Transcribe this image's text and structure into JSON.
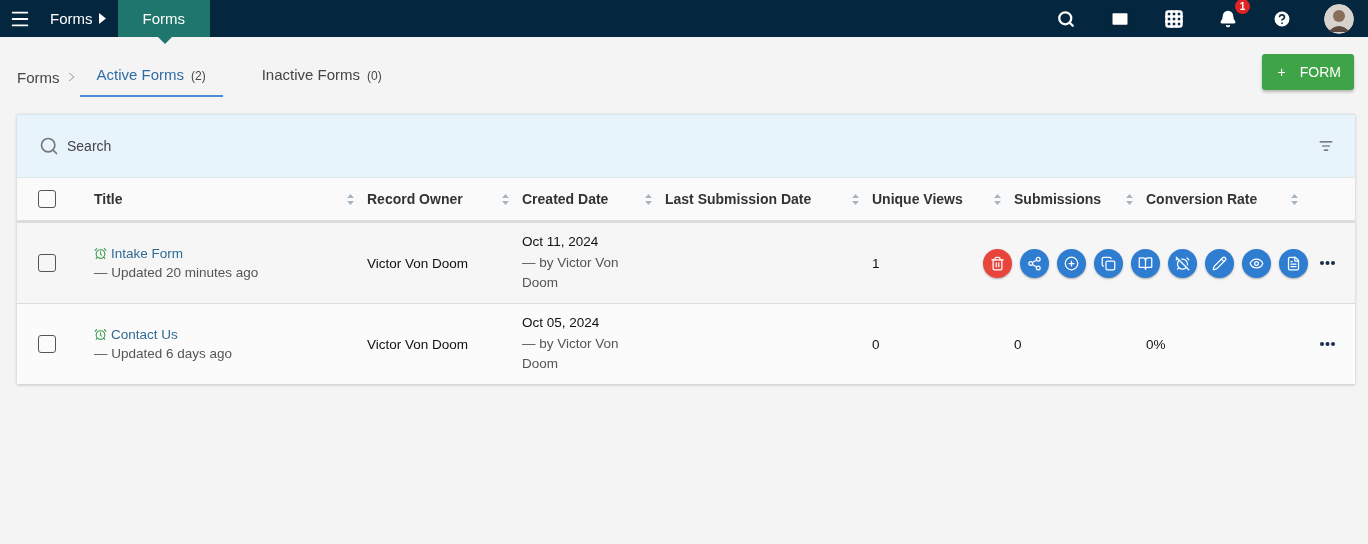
{
  "topbar": {
    "breadcrumb": "Forms",
    "current": "Forms",
    "notification_count": "1"
  },
  "tabs": {
    "root": "Forms",
    "items": [
      {
        "label": "Active Forms",
        "count": "(2)",
        "selected": true
      },
      {
        "label": "Inactive Forms",
        "count": "(0)",
        "selected": false
      }
    ]
  },
  "new_button": {
    "icon": "+",
    "label": "FORM"
  },
  "search": {
    "placeholder": "Search"
  },
  "table": {
    "select_all": {
      "checked": false
    },
    "columns": [
      "Title",
      "Record Owner",
      "Created Date",
      "Last Submission Date",
      "Unique Views",
      "Submissions",
      "Conversion Rate"
    ],
    "rows": [
      {
        "checked": false,
        "title": "Intake Form",
        "updated": "— Updated 20 minutes ago",
        "owner": "Victor Von Doom",
        "created_date": "Oct 11, 2024",
        "created_by": "— by Victor Von Doom",
        "unique_views": "1",
        "actions": [
          {
            "kind": "delete"
          },
          {
            "kind": "share"
          },
          {
            "kind": "add"
          },
          {
            "kind": "copy"
          },
          {
            "kind": "read"
          },
          {
            "kind": "alarm-off"
          },
          {
            "kind": "edit"
          },
          {
            "kind": "view"
          },
          {
            "kind": "report"
          }
        ]
      },
      {
        "checked": false,
        "title": "Contact Us",
        "updated": "— Updated 6 days ago",
        "owner": "Victor Von Doom",
        "created_date": "Oct 05, 2024",
        "created_by": "— by Victor Von Doom",
        "unique_views": "0",
        "submissions": "0",
        "conversion_rate": "0%"
      }
    ]
  }
}
